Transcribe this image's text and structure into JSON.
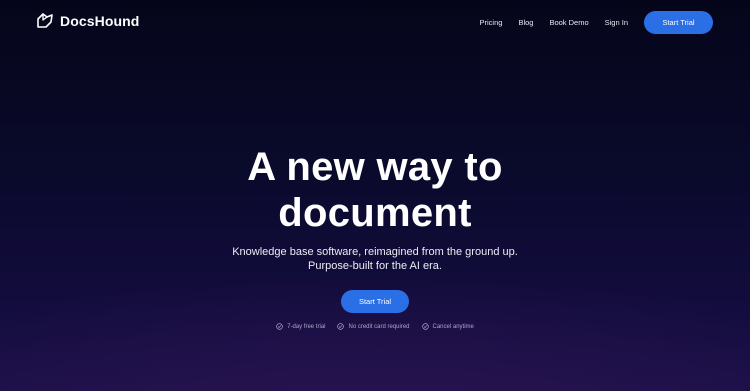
{
  "brand": {
    "name": "DocsHound",
    "logo_icon": "docshound-logo-icon"
  },
  "nav": {
    "links": [
      {
        "label": "Pricing"
      },
      {
        "label": "Blog"
      },
      {
        "label": "Book Demo"
      },
      {
        "label": "Sign In"
      }
    ],
    "cta_label": "Start Trial"
  },
  "hero": {
    "title_line1": "A new way to",
    "title_line2": "document",
    "subtitle_line1": "Knowledge base software, reimagined from the ground up.",
    "subtitle_line2": "Purpose-built for the AI era.",
    "cta_label": "Start Trial",
    "perks": [
      {
        "icon": "check-circle-icon",
        "label": "7-day free trial"
      },
      {
        "icon": "check-circle-icon",
        "label": "No credit card required"
      },
      {
        "icon": "check-circle-icon",
        "label": "Cancel anytime"
      }
    ]
  },
  "colors": {
    "accent": "#2b6fe6",
    "background_top": "#05051a",
    "background_bottom": "#1a0f48"
  }
}
